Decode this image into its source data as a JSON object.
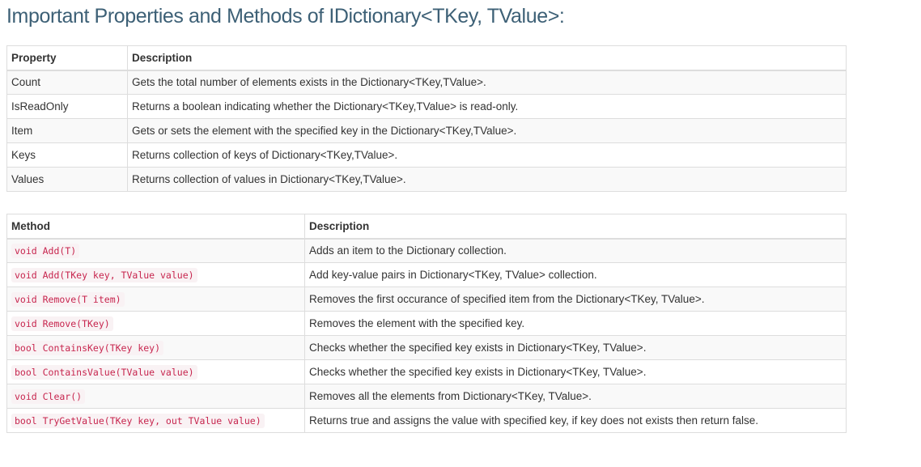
{
  "title": "Important Properties and Methods of IDictionary<TKey, TValue>:",
  "properties_table": {
    "headers": [
      "Property",
      "Description"
    ],
    "rows": [
      [
        "Count",
        "Gets the total number of elements exists in the Dictionary<TKey,TValue>."
      ],
      [
        "IsReadOnly",
        "Returns a boolean indicating whether the Dictionary<TKey,TValue> is read-only."
      ],
      [
        "Item",
        "Gets or sets the element with the specified key in the Dictionary<TKey,TValue>."
      ],
      [
        "Keys",
        "Returns collection of keys of Dictionary<TKey,TValue>."
      ],
      [
        "Values",
        "Returns collection of values in Dictionary<TKey,TValue>."
      ]
    ]
  },
  "methods_table": {
    "headers": [
      "Method",
      "Description"
    ],
    "rows": [
      [
        "void Add(T)",
        "Adds an item to the Dictionary collection."
      ],
      [
        "void Add(TKey key, TValue value)",
        "Add key-value pairs in Dictionary<TKey, TValue> collection."
      ],
      [
        "void Remove(T item)",
        "Removes the first occurance of specified item from the Dictionary<TKey, TValue>."
      ],
      [
        "void Remove(TKey)",
        "Removes the element with the specified key."
      ],
      [
        "bool ContainsKey(TKey key)",
        "Checks whether the specified key exists in Dictionary<TKey, TValue>."
      ],
      [
        "bool ContainsValue(TValue value)",
        "Checks whether the specified key exists in Dictionary<TKey, TValue>."
      ],
      [
        "void Clear()",
        "Removes all the elements from Dictionary<TKey, TValue>."
      ],
      [
        "bool TryGetValue(TKey key, out TValue value)",
        "Returns true and assigns the value with specified key, if key does not exists then return false."
      ]
    ]
  },
  "colors": {
    "title": "#3d6076",
    "text": "#333333",
    "code_text": "#c7254e",
    "code_background": "#f9f2f4",
    "row_stripe": "#f9f9f9",
    "border": "#dddddd"
  }
}
